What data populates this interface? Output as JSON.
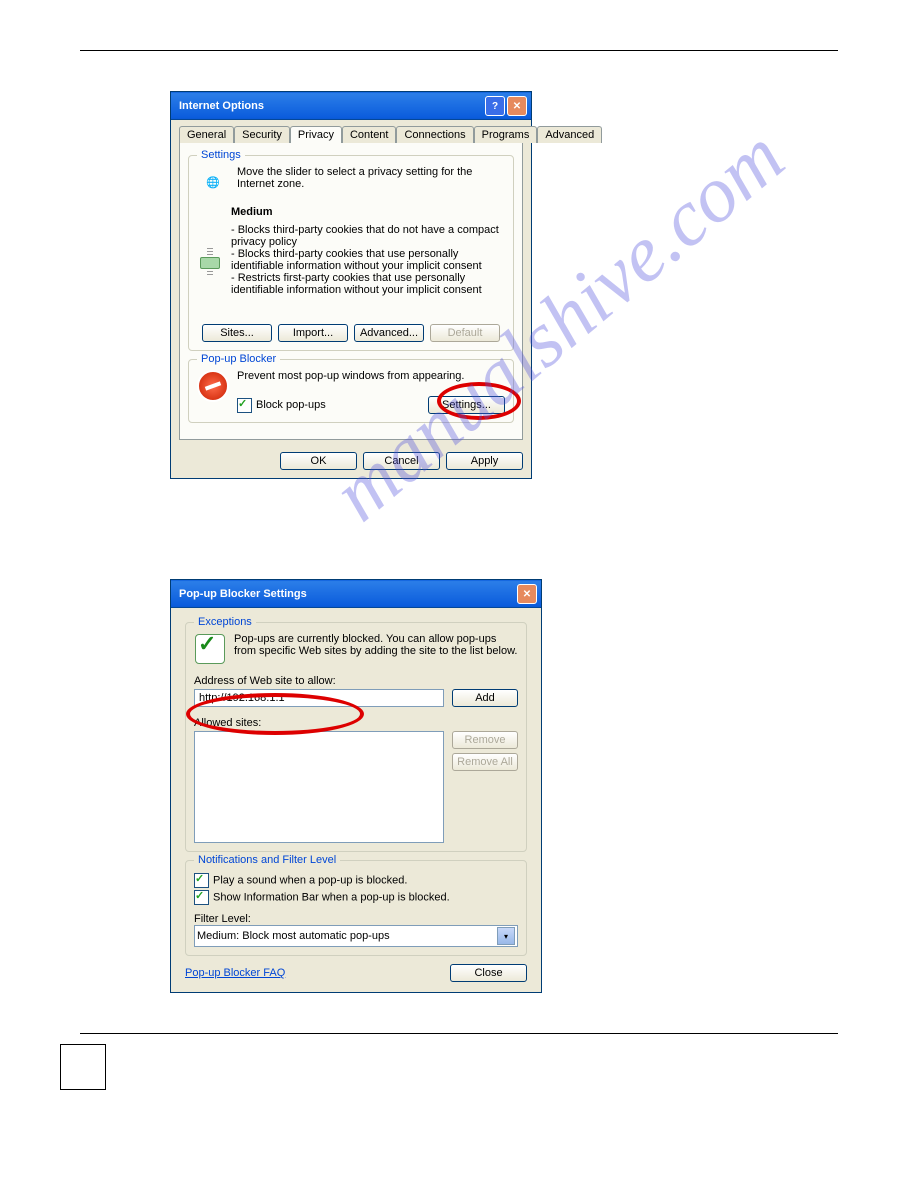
{
  "d1": {
    "title": "Internet Options",
    "tabs": [
      "General",
      "Security",
      "Privacy",
      "Content",
      "Connections",
      "Programs",
      "Advanced"
    ],
    "settings": {
      "legend": "Settings",
      "intro": "Move the slider to select a privacy setting for the Internet zone.",
      "level": "Medium",
      "lines": [
        "- Blocks third-party cookies that do not have a compact privacy policy",
        "- Blocks third-party cookies that use personally identifiable information without your implicit consent",
        "- Restricts first-party cookies that use personally identifiable information without your implicit consent"
      ],
      "btns": {
        "sites": "Sites...",
        "import": "Import...",
        "advanced": "Advanced...",
        "default": "Default"
      }
    },
    "popup": {
      "legend": "Pop-up Blocker",
      "intro": "Prevent most pop-up windows from appearing.",
      "cb": "Block pop-ups",
      "settings": "Settings..."
    },
    "footer": {
      "ok": "OK",
      "cancel": "Cancel",
      "apply": "Apply"
    }
  },
  "d2": {
    "title": "Pop-up Blocker Settings",
    "exc": {
      "legend": "Exceptions",
      "intro": "Pop-ups are currently blocked. You can allow pop-ups from specific Web sites by adding the site to the list below.",
      "addrlabel": "Address of Web site to allow:",
      "addr": "http://192.168.1.1",
      "add": "Add",
      "allowed": "Allowed sites:",
      "remove": "Remove",
      "removeall": "Remove All"
    },
    "notif": {
      "legend": "Notifications and Filter Level",
      "cb1": "Play a sound when a pop-up is blocked.",
      "cb2": "Show Information Bar when a pop-up is blocked.",
      "flabel": "Filter Level:",
      "fval": "Medium: Block most automatic pop-ups"
    },
    "faq": "Pop-up Blocker FAQ",
    "close": "Close"
  },
  "wm": "manualshive.com"
}
